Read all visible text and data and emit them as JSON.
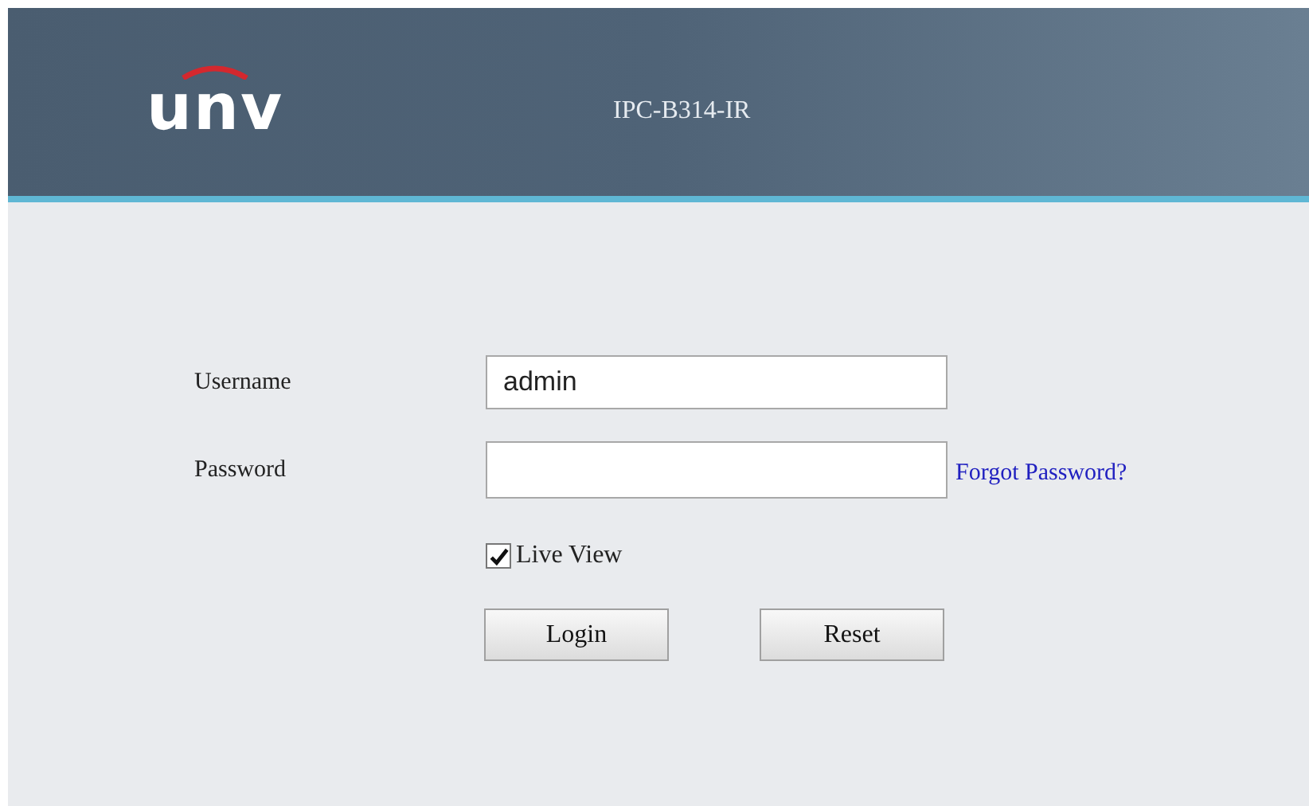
{
  "header": {
    "logo": "unv",
    "model": "IPC-B314-IR"
  },
  "form": {
    "username": {
      "label": "Username",
      "value": "admin"
    },
    "password": {
      "label": "Password"
    },
    "forgot_link": "Forgot Password?",
    "live_view": {
      "label": "Live View",
      "checked": true
    },
    "buttons": [
      "Login",
      "Reset"
    ]
  }
}
